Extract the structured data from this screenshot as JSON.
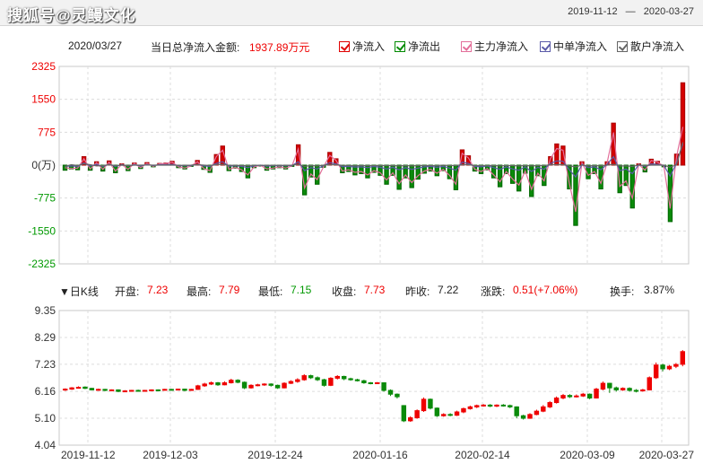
{
  "header": {
    "watermark": "搜狐号@灵鳗文化",
    "range_start": "2019-11-12",
    "range_sep": "—",
    "range_end": "2020-03-27"
  },
  "flow_info": {
    "date": "2020/03/27",
    "total_label": "当日总净流入金额:",
    "total_value": "1937.89万元"
  },
  "legend": [
    {
      "label": "净流入",
      "color": "#e00000"
    },
    {
      "label": "净流出",
      "color": "#008a00"
    },
    {
      "label": "主力净流入",
      "color": "#e36f9a"
    },
    {
      "label": "中单净流入",
      "color": "#5a5aa8"
    },
    {
      "label": "散户净流入",
      "color": "#666666"
    }
  ],
  "kline_info": {
    "title": "▼日K线",
    "open_label": "开盘:",
    "open": "7.23",
    "high_label": "最高:",
    "high": "7.79",
    "low_label": "最低:",
    "low": "7.15",
    "close_label": "收盘:",
    "close": "7.73",
    "prev_label": "昨收:",
    "prev": "7.22",
    "change_label": "涨跌:",
    "change": "0.51(+7.06%)",
    "turnover_label": "换手:",
    "turnover": "3.87%"
  },
  "chart_data": [
    {
      "type": "bar",
      "name": "净流入",
      "unit": "万",
      "yticks": [
        "2325",
        "1550",
        "775",
        "0(万)",
        "-775",
        "-1550",
        "-2325"
      ],
      "ylim": [
        -2325,
        2325
      ],
      "values": [
        -120,
        -90,
        -110,
        200,
        -120,
        80,
        -140,
        100,
        -180,
        30,
        -130,
        50,
        -80,
        60,
        -40,
        40,
        50,
        90,
        -60,
        -90,
        -30,
        110,
        -100,
        -170,
        250,
        450,
        -130,
        -70,
        -150,
        -300,
        -60,
        -10,
        -120,
        -90,
        -60,
        -90,
        -30,
        480,
        -700,
        -280,
        -450,
        -50,
        300,
        150,
        -180,
        -150,
        -230,
        -200,
        -300,
        -170,
        -240,
        -450,
        -240,
        -570,
        -300,
        -530,
        -330,
        -190,
        -140,
        -250,
        -130,
        -320,
        -580,
        360,
        220,
        -140,
        -200,
        -110,
        -300,
        -510,
        -200,
        -430,
        -610,
        -190,
        -740,
        -250,
        -480,
        200,
        500,
        450,
        -560,
        -1420,
        80,
        -320,
        -200,
        -560,
        80,
        990,
        -650,
        -480,
        -1010,
        30,
        -160,
        140,
        90,
        -40,
        -1330,
        260,
        1940
      ],
      "xticks": [
        "2019-11-12",
        "2019-12-03",
        "2019-12-24",
        "2020-01-16",
        "2020-02-14",
        "2020-03-09",
        "2020-03-27"
      ]
    },
    {
      "type": "line",
      "name": "主力净流入/中单净流入/散户净流入",
      "series": [
        {
          "name": "主力净流入",
          "color": "#e36f9a",
          "values": [
            -60,
            -80,
            -70,
            150,
            -90,
            60,
            -100,
            70,
            -140,
            20,
            -100,
            40,
            -60,
            40,
            -30,
            30,
            40,
            70,
            -40,
            -70,
            -20,
            80,
            -80,
            -130,
            200,
            350,
            -100,
            -50,
            -110,
            -230,
            -40,
            -5,
            -90,
            -70,
            -40,
            -70,
            -20,
            380,
            -540,
            -210,
            -340,
            -40,
            230,
            110,
            -140,
            -110,
            -170,
            -150,
            -230,
            -130,
            -180,
            -350,
            -180,
            -440,
            -230,
            -410,
            -250,
            -140,
            -100,
            -190,
            -100,
            -240,
            -450,
            280,
            170,
            -100,
            -150,
            -80,
            -230,
            -390,
            -150,
            -330,
            -470,
            -140,
            -570,
            -190,
            -370,
            150,
            390,
            350,
            -430,
            -1100,
            60,
            -240,
            -150,
            -430,
            60,
            770,
            -500,
            -370,
            -780,
            20,
            -120,
            110,
            70,
            -30,
            -1020,
            200,
            900
          ]
        },
        {
          "name": "中单净流入",
          "color": "#5a5aa8",
          "values": [
            -30,
            -20,
            -30,
            50,
            -20,
            20,
            -30,
            20,
            -30,
            10,
            -20,
            10,
            -20,
            15,
            -10,
            10,
            10,
            20,
            -15,
            -15,
            -10,
            20,
            -20,
            -30,
            40,
            80,
            -25,
            -15,
            -30,
            -60,
            -15,
            0,
            -25,
            -15,
            -15,
            -15,
            -10,
            80,
            -130,
            -60,
            -90,
            -10,
            60,
            30,
            -35,
            -30,
            -45,
            -40,
            -60,
            -30,
            -50,
            -90,
            -50,
            -110,
            -60,
            -100,
            -70,
            -40,
            -30,
            -50,
            -30,
            -70,
            -120,
            70,
            40,
            -30,
            -40,
            -20,
            -60,
            -100,
            -40,
            -90,
            -120,
            -40,
            -150,
            -50,
            -100,
            40,
            100,
            90,
            -110,
            -280,
            20,
            -60,
            -40,
            -110,
            20,
            200,
            -130,
            -90,
            -200,
            10,
            -30,
            30,
            20,
            -10,
            -260,
            50,
            500
          ]
        },
        {
          "name": "散户净流入",
          "color": "#666666",
          "values": [
            -30,
            10,
            -10,
            30,
            10,
            -20,
            -10,
            10,
            -10,
            0,
            -10,
            0,
            0,
            5,
            0,
            0,
            0,
            0,
            -5,
            -5,
            0,
            10,
            0,
            -10,
            10,
            20,
            -5,
            -5,
            -10,
            -10,
            -5,
            -5,
            -5,
            -5,
            -5,
            -5,
            0,
            20,
            -30,
            -10,
            -20,
            0,
            10,
            10,
            -5,
            -10,
            -15,
            -10,
            -10,
            -10,
            -10,
            -10,
            -10,
            -20,
            -10,
            -20,
            -10,
            -10,
            -10,
            -10,
            0,
            -10,
            -10,
            10,
            10,
            -10,
            -10,
            -10,
            -10,
            -20,
            -10,
            -10,
            -20,
            -10,
            -20,
            -10,
            -10,
            10,
            10,
            10,
            -20,
            -40,
            0,
            -20,
            -10,
            -20,
            0,
            20,
            -20,
            -20,
            -30,
            0,
            -10,
            0,
            0,
            0,
            -50,
            10,
            540
          ]
        }
      ]
    },
    {
      "type": "candlestick",
      "name": "日K线",
      "yticks": [
        "9.35",
        "8.29",
        "7.23",
        "6.16",
        "5.10",
        "4.04"
      ],
      "ylim": [
        4.04,
        9.35
      ],
      "xticks": [
        "2019-11-12",
        "2019-12-03",
        "2019-12-24",
        "2020-01-16",
        "2020-02-14",
        "2020-03-09",
        "2020-03-27"
      ],
      "candles": [
        [
          6.22,
          6.25,
          6.28,
          6.18
        ],
        [
          6.25,
          6.3,
          6.33,
          6.22
        ],
        [
          6.3,
          6.32,
          6.36,
          6.27
        ],
        [
          6.33,
          6.28,
          6.36,
          6.25
        ],
        [
          6.28,
          6.22,
          6.3,
          6.2
        ],
        [
          6.22,
          6.24,
          6.27,
          6.19
        ],
        [
          6.24,
          6.2,
          6.26,
          6.17
        ],
        [
          6.2,
          6.22,
          6.24,
          6.17
        ],
        [
          6.22,
          6.16,
          6.24,
          6.13
        ],
        [
          6.16,
          6.18,
          6.21,
          6.14
        ],
        [
          6.18,
          6.2,
          6.22,
          6.16
        ],
        [
          6.2,
          6.18,
          6.23,
          6.15
        ],
        [
          6.18,
          6.2,
          6.22,
          6.16
        ],
        [
          6.2,
          6.22,
          6.24,
          6.18
        ],
        [
          6.22,
          6.21,
          6.24,
          6.18
        ],
        [
          6.21,
          6.24,
          6.26,
          6.19
        ],
        [
          6.24,
          6.22,
          6.26,
          6.19
        ],
        [
          6.22,
          6.25,
          6.27,
          6.2
        ],
        [
          6.25,
          6.2,
          6.27,
          6.17
        ],
        [
          6.2,
          6.24,
          6.26,
          6.18
        ],
        [
          6.24,
          6.38,
          6.42,
          6.22
        ],
        [
          6.38,
          6.45,
          6.5,
          6.34
        ],
        [
          6.45,
          6.5,
          6.55,
          6.41
        ],
        [
          6.5,
          6.42,
          6.53,
          6.38
        ],
        [
          6.42,
          6.5,
          6.56,
          6.4
        ],
        [
          6.5,
          6.6,
          6.66,
          6.47
        ],
        [
          6.6,
          6.52,
          6.64,
          6.48
        ],
        [
          6.52,
          6.3,
          6.55,
          6.25
        ],
        [
          6.3,
          6.4,
          6.44,
          6.27
        ],
        [
          6.4,
          6.42,
          6.46,
          6.36
        ],
        [
          6.42,
          6.45,
          6.48,
          6.38
        ],
        [
          6.45,
          6.4,
          6.48,
          6.35
        ],
        [
          6.4,
          6.3,
          6.43,
          6.26
        ],
        [
          6.3,
          6.48,
          6.52,
          6.28
        ],
        [
          6.48,
          6.55,
          6.6,
          6.45
        ],
        [
          6.55,
          6.62,
          6.68,
          6.5
        ],
        [
          6.62,
          6.78,
          6.84,
          6.58
        ],
        [
          6.78,
          6.7,
          6.82,
          6.65
        ],
        [
          6.7,
          6.62,
          6.75,
          6.57
        ],
        [
          6.62,
          6.4,
          6.66,
          6.35
        ],
        [
          6.4,
          6.68,
          6.72,
          6.37
        ],
        [
          6.68,
          6.75,
          6.8,
          6.63
        ],
        [
          6.75,
          6.66,
          6.78,
          6.6
        ],
        [
          6.66,
          6.62,
          6.7,
          6.58
        ],
        [
          6.62,
          6.58,
          6.66,
          6.55
        ],
        [
          6.58,
          6.5,
          6.62,
          6.46
        ],
        [
          6.5,
          6.48,
          6.53,
          6.44
        ],
        [
          6.48,
          6.5,
          6.53,
          6.45
        ],
        [
          6.5,
          6.2,
          6.52,
          6.15
        ],
        [
          6.2,
          6.05,
          6.24,
          5.98
        ],
        [
          6.05,
          5.95,
          6.08,
          5.88
        ],
        [
          5.6,
          5.0,
          5.62,
          4.95
        ],
        [
          5.0,
          5.12,
          5.18,
          4.96
        ],
        [
          5.12,
          5.4,
          5.45,
          5.08
        ],
        [
          5.4,
          5.85,
          5.92,
          5.35
        ],
        [
          5.85,
          5.5,
          5.88,
          5.45
        ],
        [
          5.5,
          5.2,
          5.53,
          5.15
        ],
        [
          5.2,
          5.25,
          5.3,
          5.16
        ],
        [
          5.25,
          5.22,
          5.3,
          5.18
        ],
        [
          5.22,
          5.35,
          5.4,
          5.19
        ],
        [
          5.35,
          5.48,
          5.52,
          5.3
        ],
        [
          5.48,
          5.55,
          5.6,
          5.44
        ],
        [
          5.55,
          5.6,
          5.64,
          5.5
        ],
        [
          5.6,
          5.62,
          5.66,
          5.56
        ],
        [
          5.62,
          5.58,
          5.66,
          5.54
        ],
        [
          5.58,
          5.62,
          5.65,
          5.54
        ],
        [
          5.62,
          5.6,
          5.66,
          5.56
        ],
        [
          5.6,
          5.55,
          5.64,
          5.5
        ],
        [
          5.55,
          5.2,
          5.57,
          5.1
        ],
        [
          5.2,
          5.1,
          5.24,
          5.05
        ],
        [
          5.1,
          5.25,
          5.3,
          5.08
        ],
        [
          5.25,
          5.38,
          5.44,
          5.22
        ],
        [
          5.38,
          5.55,
          5.62,
          5.34
        ],
        [
          5.55,
          5.72,
          5.78,
          5.5
        ],
        [
          5.72,
          5.9,
          5.96,
          5.68
        ],
        [
          5.9,
          6.0,
          6.06,
          5.85
        ],
        [
          6.0,
          5.95,
          6.05,
          5.9
        ],
        [
          5.95,
          5.98,
          6.04,
          5.92
        ],
        [
          5.98,
          6.05,
          6.1,
          5.94
        ],
        [
          6.05,
          5.9,
          6.08,
          5.85
        ],
        [
          5.9,
          6.25,
          6.3,
          5.88
        ],
        [
          6.25,
          6.48,
          6.55,
          6.2
        ],
        [
          6.48,
          6.3,
          6.5,
          6.1
        ],
        [
          6.3,
          6.22,
          6.35,
          6.15
        ],
        [
          6.22,
          6.28,
          6.32,
          6.18
        ],
        [
          6.28,
          6.2,
          6.32,
          6.15
        ],
        [
          6.2,
          6.18,
          6.25,
          6.12
        ],
        [
          6.18,
          6.22,
          6.26,
          6.15
        ],
        [
          6.22,
          6.7,
          6.75,
          6.2
        ],
        [
          6.7,
          7.2,
          7.3,
          6.65
        ],
        [
          7.2,
          7.05,
          7.25,
          6.95
        ],
        [
          7.05,
          7.15,
          7.2,
          7.0
        ],
        [
          7.15,
          7.22,
          7.28,
          7.08
        ],
        [
          7.23,
          7.73,
          7.79,
          7.15
        ]
      ]
    }
  ]
}
